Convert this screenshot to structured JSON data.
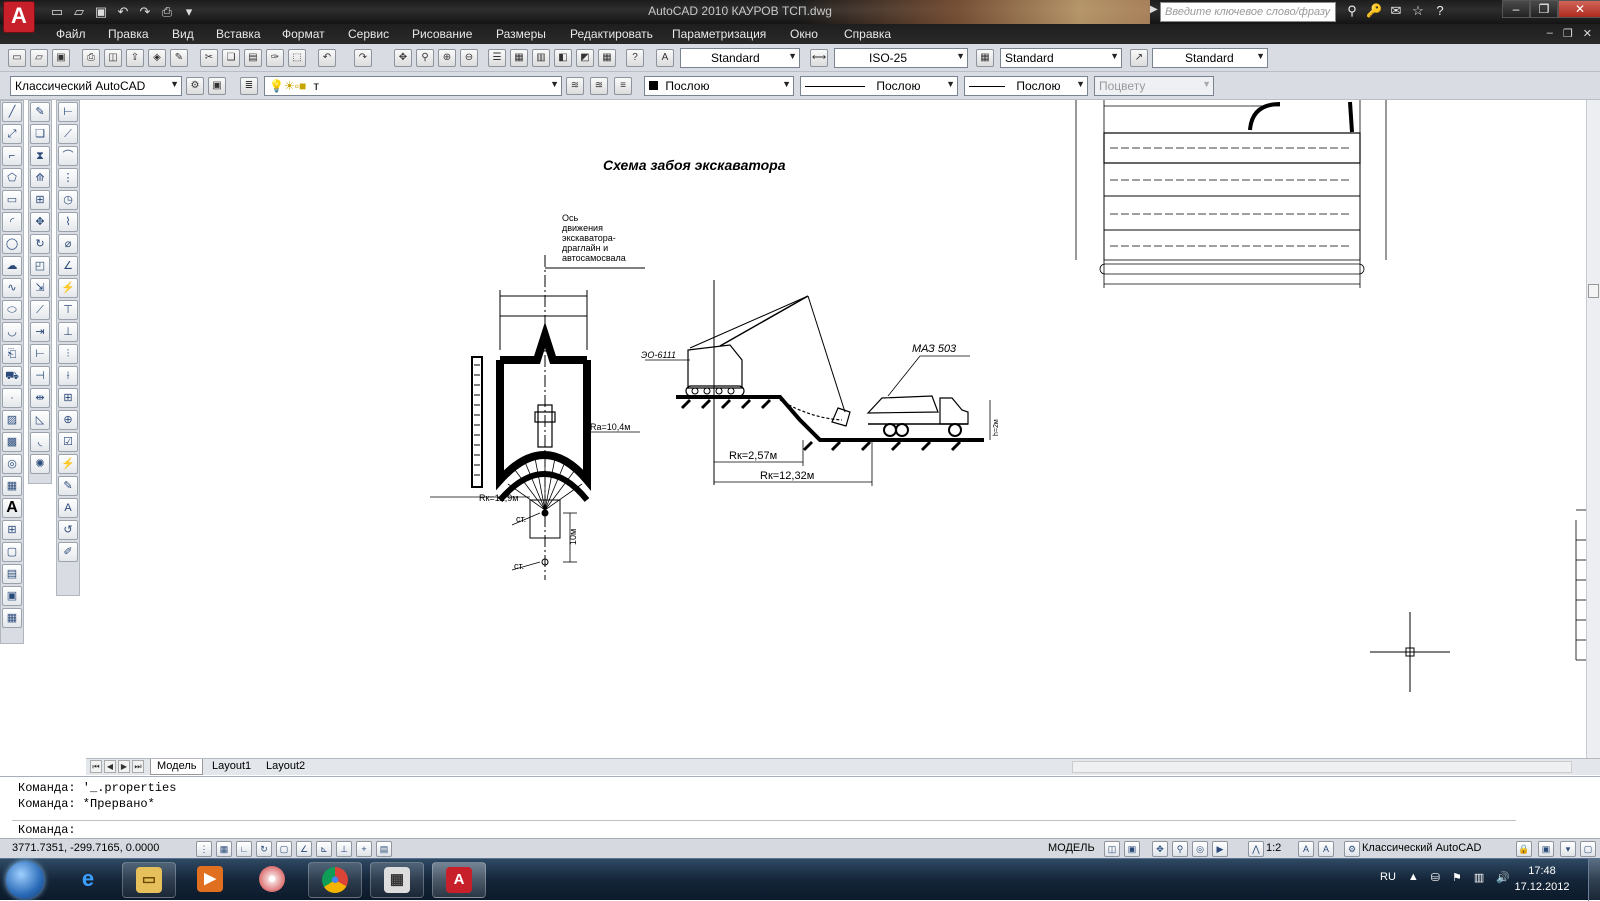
{
  "window": {
    "title": "AutoCAD 2010    КАУРОВ ТСП.dwg",
    "search_placeholder": "Введите ключевое слово/фразу"
  },
  "menu": {
    "items": [
      "Файл",
      "Правка",
      "Вид",
      "Вставка",
      "Формат",
      "Сервис",
      "Рисование",
      "Размеры",
      "Редактировать",
      "Параметризация",
      "Окно",
      "Справка"
    ]
  },
  "toolbars": {
    "text_style": "Standard",
    "dim_style": "ISO-25",
    "table_style": "Standard",
    "mleader_style": "Standard",
    "workspace": "Классический AutoCAD",
    "layer": "т",
    "color": "Послою",
    "linetype": "Послою",
    "lineweight": "Послою",
    "plotstyle": "Поцвету"
  },
  "drawing": {
    "title": "Схема забоя экскаватора",
    "axis_note": [
      "Ось",
      "движения",
      "экскаватора-",
      "драглайн и",
      "автосамосвала"
    ],
    "r_a": "Rа=10,4м",
    "r_k1": "Rк=12,9м",
    "st1": "ст.",
    "st2": "ст.",
    "dim_10": "10м",
    "eo": "ЭО-6111",
    "maz": "МАЗ 503",
    "rk_257": "Rк=2,57м",
    "rk_1232": "Rк=12,32м",
    "h_label": "h=2м"
  },
  "tabs": [
    "Модель",
    "Layout1",
    "Layout2"
  ],
  "command": {
    "line1": "Команда: '_.properties",
    "line2": "Команда: *Прервано*",
    "prompt": "Команда:"
  },
  "status": {
    "coords": "3771.7351, -299.7165, 0.0000",
    "model": "МОДЕЛЬ",
    "scale": "1:2",
    "workspace": "Классический AutoCAD"
  },
  "tray": {
    "lang": "RU",
    "time": "17:48",
    "date": "17.12.2012"
  }
}
